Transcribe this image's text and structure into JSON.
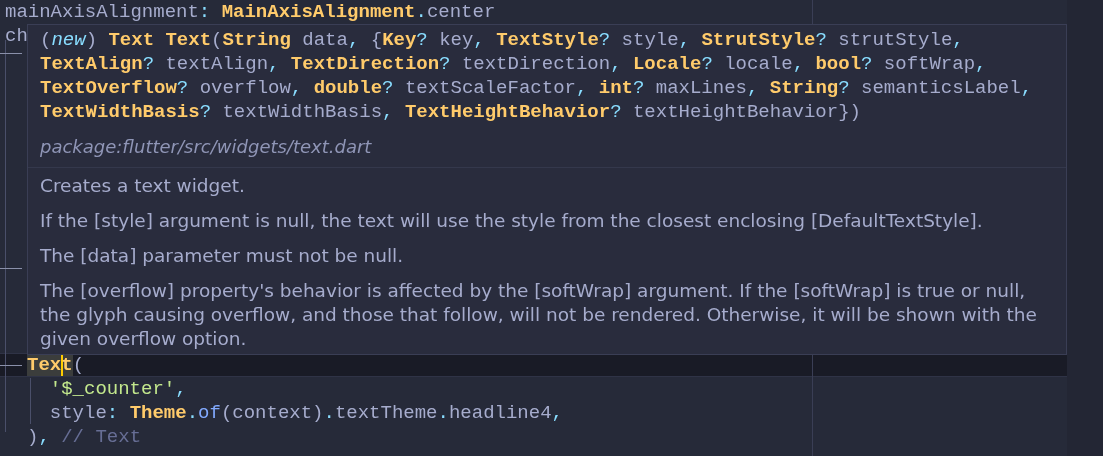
{
  "editor": {
    "top_lines": [
      {
        "current": false,
        "tokens": [
          {
            "kind": "name",
            "text": "mainAxisAlignment"
          },
          {
            "kind": "punct",
            "text": ":"
          },
          {
            "kind": "type",
            "text": " MainAxisAlignment"
          },
          {
            "kind": "punct",
            "text": "."
          },
          {
            "kind": "name",
            "text": "center"
          }
        ]
      },
      {
        "current": false,
        "tokens": [
          {
            "kind": "name",
            "text": "ch"
          }
        ]
      }
    ],
    "bottom_lines": [
      {
        "current": true,
        "tokens": [
          {
            "kind": "type",
            "text": "Tex",
            "highlighted": true,
            "cursor_before": false
          },
          {
            "kind": "type",
            "text": "t",
            "highlighted": true,
            "cursor_before": true
          },
          {
            "kind": "plain",
            "text": "("
          }
        ]
      },
      {
        "current": false,
        "tokens": [
          {
            "kind": "string",
            "text": "  '$_counter'"
          },
          {
            "kind": "punct",
            "text": ","
          }
        ]
      },
      {
        "current": false,
        "tokens": [
          {
            "kind": "name",
            "text": "  style"
          },
          {
            "kind": "punct",
            "text": ":"
          },
          {
            "kind": "type",
            "text": " Theme"
          },
          {
            "kind": "punct",
            "text": "."
          },
          {
            "kind": "func",
            "text": "of"
          },
          {
            "kind": "plain",
            "text": "(context)"
          },
          {
            "kind": "punct",
            "text": "."
          },
          {
            "kind": "name",
            "text": "textTheme"
          },
          {
            "kind": "punct",
            "text": "."
          },
          {
            "kind": "name",
            "text": "headline4"
          },
          {
            "kind": "punct",
            "text": ","
          }
        ]
      },
      {
        "current": false,
        "tokens": [
          {
            "kind": "plain",
            "text": ")"
          },
          {
            "kind": "punct",
            "text": ","
          },
          {
            "kind": "comment",
            "text": " // Text"
          }
        ]
      }
    ]
  },
  "hover": {
    "signature": [
      {
        "tokens": [
          {
            "kind": "plain",
            "text": "("
          },
          {
            "kind": "keyword",
            "text": "new"
          },
          {
            "kind": "plain",
            "text": ")"
          },
          {
            "kind": "type",
            "text": " Text Text"
          },
          {
            "kind": "plain",
            "text": "("
          },
          {
            "kind": "type",
            "text": "String"
          },
          {
            "kind": "name",
            "text": " data"
          },
          {
            "kind": "punct",
            "text": ","
          },
          {
            "kind": "plain",
            "text": " {"
          },
          {
            "kind": "type",
            "text": "Key"
          },
          {
            "kind": "punct",
            "text": "?"
          },
          {
            "kind": "name",
            "text": " key"
          },
          {
            "kind": "punct",
            "text": ","
          },
          {
            "kind": "type",
            "text": " TextStyle"
          },
          {
            "kind": "punct",
            "text": "?"
          },
          {
            "kind": "name",
            "text": " style"
          },
          {
            "kind": "punct",
            "text": ","
          },
          {
            "kind": "type",
            "text": " StrutStyle"
          },
          {
            "kind": "punct",
            "text": "?"
          },
          {
            "kind": "name",
            "text": " strutStyle"
          },
          {
            "kind": "punct",
            "text": ","
          }
        ]
      },
      {
        "tokens": [
          {
            "kind": "type",
            "text": "TextAlign"
          },
          {
            "kind": "punct",
            "text": "?"
          },
          {
            "kind": "name",
            "text": " textAlign"
          },
          {
            "kind": "punct",
            "text": ","
          },
          {
            "kind": "type",
            "text": " TextDirection"
          },
          {
            "kind": "punct",
            "text": "?"
          },
          {
            "kind": "name",
            "text": " textDirection"
          },
          {
            "kind": "punct",
            "text": ","
          },
          {
            "kind": "type",
            "text": " Locale"
          },
          {
            "kind": "punct",
            "text": "?"
          },
          {
            "kind": "name",
            "text": " locale"
          },
          {
            "kind": "punct",
            "text": ","
          },
          {
            "kind": "type",
            "text": " bool"
          },
          {
            "kind": "punct",
            "text": "?"
          },
          {
            "kind": "name",
            "text": " softWrap"
          },
          {
            "kind": "punct",
            "text": ","
          }
        ]
      },
      {
        "tokens": [
          {
            "kind": "type",
            "text": "TextOverflow"
          },
          {
            "kind": "punct",
            "text": "?"
          },
          {
            "kind": "name",
            "text": " overflow"
          },
          {
            "kind": "punct",
            "text": ","
          },
          {
            "kind": "type",
            "text": " double"
          },
          {
            "kind": "punct",
            "text": "?"
          },
          {
            "kind": "name",
            "text": " textScaleFactor"
          },
          {
            "kind": "punct",
            "text": ","
          },
          {
            "kind": "type",
            "text": " int"
          },
          {
            "kind": "punct",
            "text": "?"
          },
          {
            "kind": "name",
            "text": " maxLines"
          },
          {
            "kind": "punct",
            "text": ","
          },
          {
            "kind": "type",
            "text": " String"
          },
          {
            "kind": "punct",
            "text": "?"
          },
          {
            "kind": "name",
            "text": " semanticsLabel"
          },
          {
            "kind": "punct",
            "text": ","
          }
        ]
      },
      {
        "tokens": [
          {
            "kind": "type",
            "text": "TextWidthBasis"
          },
          {
            "kind": "punct",
            "text": "?"
          },
          {
            "kind": "name",
            "text": " textWidthBasis"
          },
          {
            "kind": "punct",
            "text": ","
          },
          {
            "kind": "type",
            "text": " TextHeightBehavior"
          },
          {
            "kind": "punct",
            "text": "?"
          },
          {
            "kind": "name",
            "text": " textHeightBehavior"
          },
          {
            "kind": "plain",
            "text": "})"
          }
        ]
      }
    ],
    "source": "package:flutter/src/widgets/text.dart",
    "paragraphs": [
      "Creates a text widget.",
      "If the [style] argument is null, the text will use the style from the closest enclosing [DefaultTextStyle].",
      "The [data] parameter must not be null.",
      "The [overflow] property's behavior is affected by the [softWrap] argument. If the [softWrap] is true or null, the glyph causing overflow, and those that follow, will not be rendered. Otherwise, it will be shown with the given overflow option."
    ]
  }
}
